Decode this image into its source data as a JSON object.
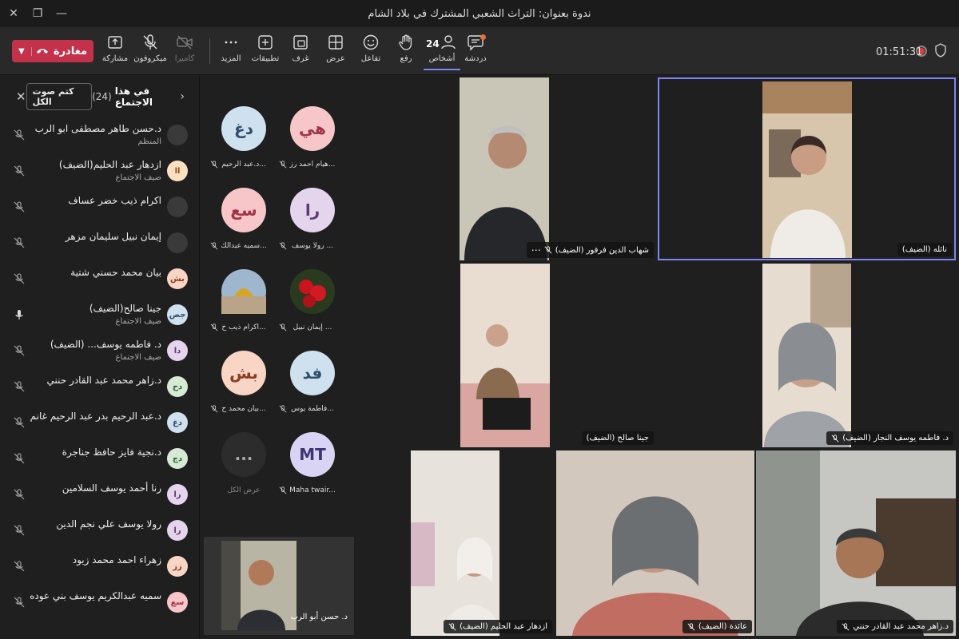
{
  "window": {
    "title": "ندوة بعنوان: التراث الشعبي المشترك في بلاد الشام"
  },
  "toolbar": {
    "timer": "01:51:31",
    "chat": "دردشة",
    "people": "أشخاص",
    "people_count": "24",
    "raise": "رفع",
    "react": "تفاعل",
    "view": "عرض",
    "rooms": "غرف",
    "apps": "تطبيقات",
    "more": "المزيد",
    "camera": "كاميرا",
    "mic": "ميكروفون",
    "share": "مشاركة",
    "leave": "مغادرة"
  },
  "panel": {
    "title": "في هذا الاجتماع",
    "count": "(24)",
    "mute_all": "كتم صوت الكل",
    "participants": [
      {
        "name": "د.حسن طاهر مصطفى ابو الرب",
        "role": "المنظم",
        "initials": "",
        "mic": "muted"
      },
      {
        "name": "ازدهار عبد الحليم(الضيف)",
        "role": "ضيف الاجتماع",
        "initials": "اا",
        "mic": "muted"
      },
      {
        "name": "اكرام ذيب خضر عساف",
        "role": "",
        "initials": "",
        "mic": "muted"
      },
      {
        "name": "إيمان نبيل سليمان مزهر",
        "role": "",
        "initials": "",
        "mic": "muted"
      },
      {
        "name": "بيان محمد حسني شتية",
        "role": "",
        "initials": "بش",
        "mic": "muted"
      },
      {
        "name": "جينا صالح(الضيف)",
        "role": "ضيف الاجتماع",
        "initials": "جص",
        "mic": "on"
      },
      {
        "name": "د. فاطمه يوسف... (الضيف)",
        "role": "ضيف الاجتماع",
        "initials": "دا",
        "mic": "muted"
      },
      {
        "name": "د.زاهر محمد عبد القادر حنني",
        "role": "",
        "initials": "دح",
        "mic": "muted"
      },
      {
        "name": "د.عبد الرحيم بدر عبد الرحيم غانم",
        "role": "",
        "initials": "دغ",
        "mic": "muted"
      },
      {
        "name": "د.نجية فايز حافظ جناجرة",
        "role": "",
        "initials": "دج",
        "mic": "muted"
      },
      {
        "name": "رنا أحمد يوسف السلامين",
        "role": "",
        "initials": "را",
        "mic": "muted"
      },
      {
        "name": "رولا يوسف علي نجم الدين",
        "role": "",
        "initials": "را",
        "mic": "muted"
      },
      {
        "name": "زهراء احمد محمد زيود",
        "role": "",
        "initials": "زز",
        "mic": "muted"
      },
      {
        "name": "سميه عبدالكريم يوسف بني عوده",
        "role": "",
        "initials": "سع",
        "mic": "muted"
      }
    ]
  },
  "gallery": {
    "tiles": [
      {
        "initials": "هي",
        "name": "هيام احمد رز...",
        "bg": "#f6c6c9",
        "fg": "#a23446"
      },
      {
        "initials": "دغ",
        "name": "د.عبد الرحيم...",
        "bg": "#cfe0ee",
        "fg": "#2e4e6b"
      },
      {
        "initials": "را",
        "name": "رولا يوسف ...",
        "bg": "#e4d4ec",
        "fg": "#5d3a73"
      },
      {
        "initials": "سع",
        "name": "سميه عبدالك...",
        "bg": "#f6c6c9",
        "fg": "#a23446"
      },
      {
        "initials": "",
        "name": "إيمان نبيل ...",
        "bg": "#2a2a2a",
        "fg": "#fff"
      },
      {
        "initials": "",
        "name": "اكرام ذيب خ...",
        "bg": "#2a2a2a",
        "fg": "#fff"
      },
      {
        "initials": "فد",
        "name": "فاطمة يوس...",
        "bg": "#cfe0ee",
        "fg": "#2e4e6b"
      },
      {
        "initials": "بش",
        "name": "بيان محمد ح...",
        "bg": "#f8d5c4",
        "fg": "#8f3d22"
      },
      {
        "initials": "MT",
        "name": "Maha twair...",
        "bg": "#d9d4f4",
        "fg": "#3e3672"
      },
      {
        "initials": "...",
        "name": "عرض الكل",
        "bg": "#2c2c2c",
        "fg": "#aaa"
      }
    ],
    "pinned_name": "د. حسن أبو الرب"
  },
  "videos": [
    {
      "name": "نائله (الضيف)",
      "muted": false
    },
    {
      "name": "شهاب الدين فرفور (الضيف)",
      "muted": true
    },
    {
      "name": "د. فاطمه يوسف النجار (الضيف)",
      "muted": true
    },
    {
      "name": "جينا صالح (الضيف)",
      "muted": false
    },
    {
      "name": "د.زاهر محمد عبد القادر حنني",
      "muted": true
    },
    {
      "name": "عائدة (الضيف)",
      "muted": true
    },
    {
      "name": "ازدهار عبد الحليم (الضيف)",
      "muted": true
    }
  ],
  "colors": {
    "accent": "#7f85f5",
    "leave": "#c4314b",
    "bg": "#1f1f1f",
    "toolbar": "#292929"
  }
}
